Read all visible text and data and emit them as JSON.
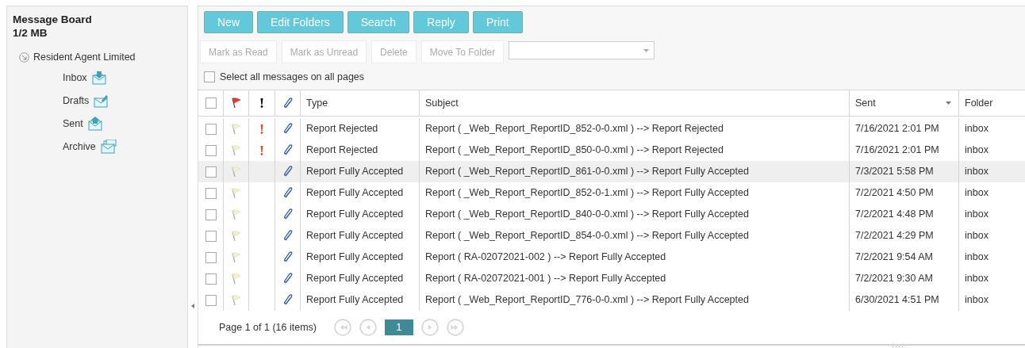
{
  "sidebar": {
    "title": "Message Board",
    "quota": "1/2 MB",
    "account": {
      "label": "Resident Agent Limited",
      "expanded": true,
      "children": [
        {
          "label": "Inbox",
          "kind": "inbox"
        },
        {
          "label": "Drafts",
          "kind": "drafts"
        },
        {
          "label": "Sent",
          "kind": "sent"
        },
        {
          "label": "Archive",
          "kind": "archive"
        }
      ]
    }
  },
  "toolbar": {
    "primary": [
      {
        "label": "New"
      },
      {
        "label": "Edit Folders"
      },
      {
        "label": "Search"
      },
      {
        "label": "Reply"
      },
      {
        "label": "Print"
      }
    ],
    "secondary": [
      {
        "label": "Mark as Read",
        "disabled": true
      },
      {
        "label": "Mark as Unread",
        "disabled": true
      },
      {
        "label": "Delete",
        "disabled": true
      },
      {
        "label": "Move To Folder",
        "disabled": true
      }
    ],
    "select_all": {
      "label": "Select all messages on all pages",
      "checked": false
    }
  },
  "table": {
    "columns": [
      {
        "kind": "check",
        "checked": false
      },
      {
        "kind": "flag"
      },
      {
        "kind": "importance"
      },
      {
        "kind": "attachment"
      },
      {
        "kind": "text",
        "label": "Type"
      },
      {
        "kind": "text",
        "label": "Subject"
      },
      {
        "kind": "sort",
        "label": "Sent"
      },
      {
        "kind": "text",
        "label": "Folder"
      }
    ],
    "rows": [
      {
        "checked": false,
        "flagged": false,
        "important": true,
        "attachment": true,
        "selected": false,
        "type": "Report Rejected",
        "subject": "Report ( _Web_Report_ReportID_852-0-0.xml ) --> Report Rejected",
        "sent": "7/16/2021 2:01 PM",
        "folder": "inbox"
      },
      {
        "checked": false,
        "flagged": false,
        "important": true,
        "attachment": true,
        "selected": false,
        "type": "Report Rejected",
        "subject": "Report ( _Web_Report_ReportID_850-0-0.xml ) --> Report Rejected",
        "sent": "7/16/2021 2:01 PM",
        "folder": "inbox"
      },
      {
        "checked": false,
        "flagged": false,
        "important": false,
        "attachment": true,
        "selected": true,
        "type": "Report Fully Accepted",
        "subject": "Report ( _Web_Report_ReportID_861-0-0.xml ) --> Report Fully Accepted",
        "sent": "7/3/2021 5:58 PM",
        "folder": "inbox"
      },
      {
        "checked": false,
        "flagged": false,
        "important": false,
        "attachment": true,
        "selected": false,
        "type": "Report Fully Accepted",
        "subject": "Report ( _Web_Report_ReportID_852-0-1.xml ) --> Report Fully Accepted",
        "sent": "7/2/2021 4:50 PM",
        "folder": "inbox"
      },
      {
        "checked": false,
        "flagged": false,
        "important": false,
        "attachment": true,
        "selected": false,
        "type": "Report Fully Accepted",
        "subject": "Report ( _Web_Report_ReportID_840-0-0.xml ) --> Report Fully Accepted",
        "sent": "7/2/2021 4:48 PM",
        "folder": "inbox"
      },
      {
        "checked": false,
        "flagged": false,
        "important": false,
        "attachment": true,
        "selected": false,
        "type": "Report Fully Accepted",
        "subject": "Report ( _Web_Report_ReportID_854-0-0.xml ) --> Report Fully Accepted",
        "sent": "7/2/2021 4:29 PM",
        "folder": "inbox"
      },
      {
        "checked": false,
        "flagged": false,
        "important": false,
        "attachment": true,
        "selected": false,
        "type": "Report Fully Accepted",
        "subject": "Report ( RA-02072021-002 ) --> Report Fully Accepted",
        "sent": "7/2/2021 9:54 AM",
        "folder": "inbox"
      },
      {
        "checked": false,
        "flagged": false,
        "important": false,
        "attachment": true,
        "selected": false,
        "type": "Report Fully Accepted",
        "subject": "Report ( RA-02072021-001 ) --> Report Fully Accepted",
        "sent": "7/2/2021 9:30 AM",
        "folder": "inbox"
      },
      {
        "checked": false,
        "flagged": false,
        "important": false,
        "attachment": true,
        "selected": false,
        "type": "Report Fully Accepted",
        "subject": "Report ( _Web_Report_ReportID_776-0-0.xml ) --> Report Fully Accepted",
        "sent": "6/30/2021 4:51 PM",
        "folder": "inbox"
      }
    ]
  },
  "pager": {
    "summary": "Page 1 of 1 (16 items)",
    "pages": [
      {
        "label": "1",
        "selected": true
      }
    ]
  }
}
